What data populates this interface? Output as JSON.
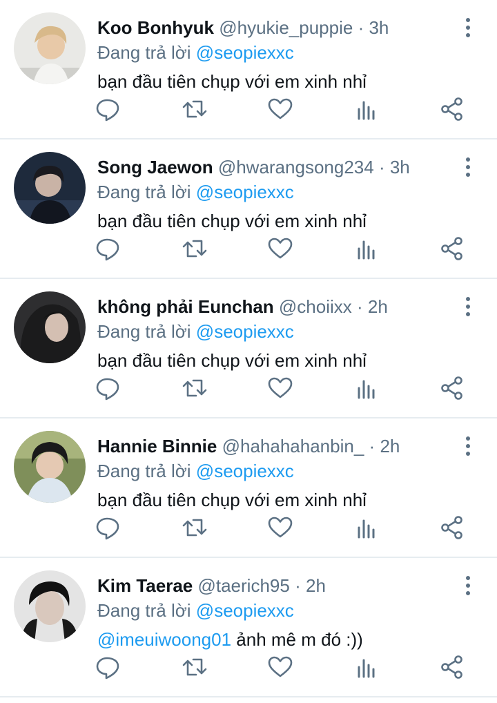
{
  "replying_prefix": "Đang trả lời",
  "colors": {
    "handle": "#5b7083",
    "mention": "#1d9bf0",
    "divider": "#e6ecf0"
  },
  "tweets": [
    {
      "name": "Koo Bonhyuk",
      "handle": "@hyukie_puppie",
      "time": "3h",
      "replying_to": "@seopiexxc",
      "body_mention": "",
      "body": "bạn đầu tiên chụp với em xinh nhỉ"
    },
    {
      "name": "Song Jaewon",
      "handle": "@hwarangsong234",
      "time": "3h",
      "replying_to": "@seopiexxc",
      "body_mention": "",
      "body": "bạn đầu tiên chụp với em xinh nhỉ"
    },
    {
      "name": "không phải Eunchan",
      "handle": "@choiixx",
      "time": "2h",
      "replying_to": "@seopiexxc",
      "body_mention": "",
      "body": "bạn đầu tiên chụp với em xinh nhỉ"
    },
    {
      "name": "Hannie Binnie",
      "handle": "@hahahahanbin_",
      "time": "2h",
      "replying_to": "@seopiexxc",
      "body_mention": "",
      "body": "bạn đầu tiên chụp với em xinh nhỉ"
    },
    {
      "name": "Kim Taerae ",
      "handle": "@taerich95",
      "time": "2h",
      "replying_to": "@seopiexxc",
      "body_mention": "@imeuiwoong01",
      "body": " ảnh mê m đó :))"
    }
  ]
}
